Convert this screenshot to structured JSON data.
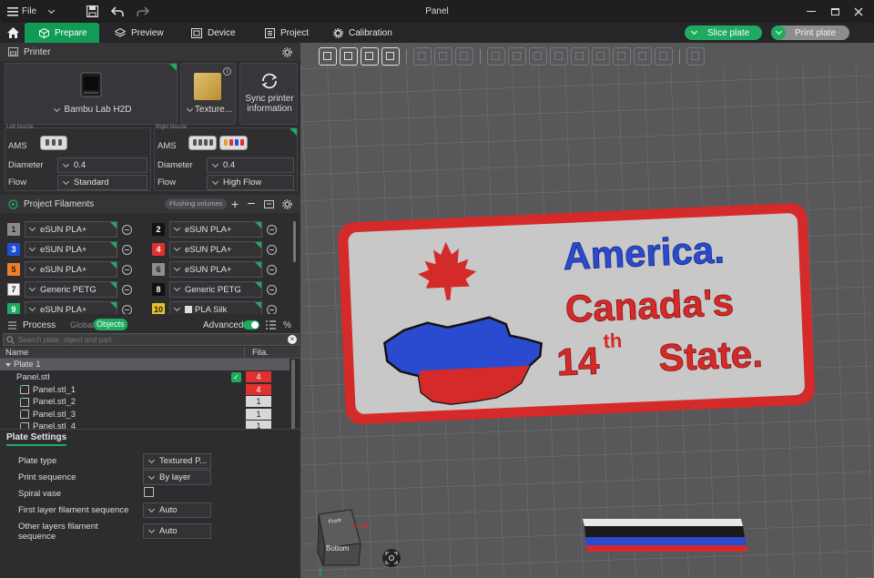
{
  "titlebar": {
    "file_label": "File",
    "title": "Panel"
  },
  "tabs": [
    {
      "label": "Prepare"
    },
    {
      "label": "Preview"
    },
    {
      "label": "Device"
    },
    {
      "label": "Project"
    },
    {
      "label": "Calibration"
    }
  ],
  "actions": {
    "slice_label": "Slice plate",
    "print_label": "Print plate"
  },
  "printer": {
    "section_title": "Printer",
    "printer_name": "Bambu Lab H2D",
    "plate_name": "Texture...",
    "sync_label_1": "Sync printer",
    "sync_label_2": "information"
  },
  "nozzles": {
    "left": {
      "title": "Left Nozzle",
      "ams_label": "AMS",
      "diameter_label": "Diameter",
      "diameter": "0.4",
      "flow_label": "Flow",
      "flow": "Standard"
    },
    "right": {
      "title": "Right Nozzle",
      "ams_label": "AMS",
      "diameter_label": "Diameter",
      "diameter": "0.4",
      "flow_label": "Flow",
      "flow": "High Flow"
    }
  },
  "filaments": {
    "section_title": "Project Filaments",
    "flushing_label": "Flushing volumes",
    "items": [
      {
        "num": "1",
        "name": "eSUN PLA+",
        "color": "#8a8a8a",
        "text_color": "#222222"
      },
      {
        "num": "2",
        "name": "eSUN PLA+",
        "color": "#111111",
        "text_color": "#ffffff"
      },
      {
        "num": "3",
        "name": "eSUN PLA+",
        "color": "#1f4fd6",
        "text_color": "#ffffff"
      },
      {
        "num": "4",
        "name": "eSUN PLA+",
        "color": "#e03030",
        "text_color": "#ffffff"
      },
      {
        "num": "5",
        "name": "eSUN PLA+",
        "color": "#f07f2a",
        "text_color": "#222222"
      },
      {
        "num": "6",
        "name": "eSUN PLA+",
        "color": "#8e8e8e",
        "text_color": "#222222"
      },
      {
        "num": "7",
        "name": "Generic PETG",
        "color": "#f2f2f2",
        "text_color": "#222222"
      },
      {
        "num": "8",
        "name": "Generic PETG",
        "color": "#111111",
        "text_color": "#ffffff"
      },
      {
        "num": "9",
        "name": "eSUN PLA+",
        "color": "#1eaa5f",
        "text_color": "#ffffff"
      },
      {
        "num": "10",
        "name": "PLA Silk",
        "color": "#e8c22a",
        "text_color": "#222222"
      }
    ]
  },
  "process": {
    "title": "Process",
    "global_label": "Global",
    "objects_label": "Objects",
    "advanced_label": "Advanced"
  },
  "objects": {
    "search_placeholder": "Search plate, object and part.",
    "col_name": "Name",
    "col_fila": "Fila.",
    "plate_label": "Plate 1",
    "rows": [
      {
        "name": "Panel.stl",
        "fila": "4",
        "fila_color": "#e03030"
      },
      {
        "name": "Panel.stl_1",
        "fila": "4",
        "fila_color": "#e03030"
      },
      {
        "name": "Panel.stl_2",
        "fila": "1",
        "fila_color": "#d8d8d8"
      },
      {
        "name": "Panel.stl_3",
        "fila": "1",
        "fila_color": "#d8d8d8"
      },
      {
        "name": "Panel.stl_4",
        "fila": "1",
        "fila_color": "#d8d8d8"
      }
    ]
  },
  "plate_settings": {
    "title": "Plate Settings",
    "plate_type_label": "Plate type",
    "plate_type": "Textured P...",
    "print_seq_label": "Print sequence",
    "print_seq": "By layer",
    "spiral_label": "Spiral vase",
    "first_layer_label": "First layer filament sequence",
    "first_layer": "Auto",
    "other_layers_label_1": "Other layers filament",
    "other_layers_label_2": "sequence",
    "other_layers": "Auto"
  },
  "model": {
    "line1": "America.",
    "line2": "Canada's",
    "line3a": "14",
    "line3sup": "th",
    "line3b": "State."
  },
  "nav_cube": {
    "front": "Front",
    "bottom": "Bottom"
  }
}
